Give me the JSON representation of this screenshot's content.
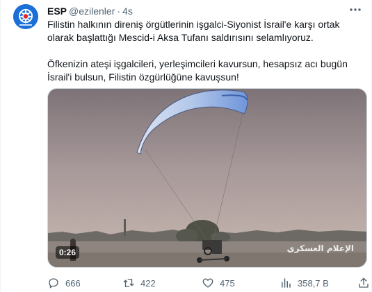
{
  "tweet": {
    "author_name": "ESP",
    "author_handle": "@ezilenler",
    "separator": "·",
    "time": "4s",
    "paragraphs": [
      "Filistin halkının direniş örgütlerinin işgalci-Siyonist İsrail'e karşı ortak olarak başlattığı Mescid-i Aksa Tufanı saldırısını selamlıyoruz.",
      "Öfkenizin ateşi işgalcileri, yerleşimcileri kavursun, hesapsız acı bugün İsrail'i bulsun, Filistin özgürlüğüne kavuşsun!"
    ],
    "video": {
      "duration": "0:26",
      "watermark": "الإعلام العسكري"
    },
    "stats": {
      "replies": "666",
      "retweets": "422",
      "likes": "475",
      "views": "358,7 B"
    }
  },
  "icons": {
    "avatar": "esp-logo-icon",
    "more": "more-icon",
    "reply": "reply-icon",
    "retweet": "retweet-icon",
    "like": "heart-icon",
    "views": "views-icon",
    "share": "share-icon"
  },
  "colors": {
    "text": "#0f1419",
    "muted": "#536471",
    "avatar_bg": "#1d6fd8",
    "border": "#cfd9de"
  }
}
